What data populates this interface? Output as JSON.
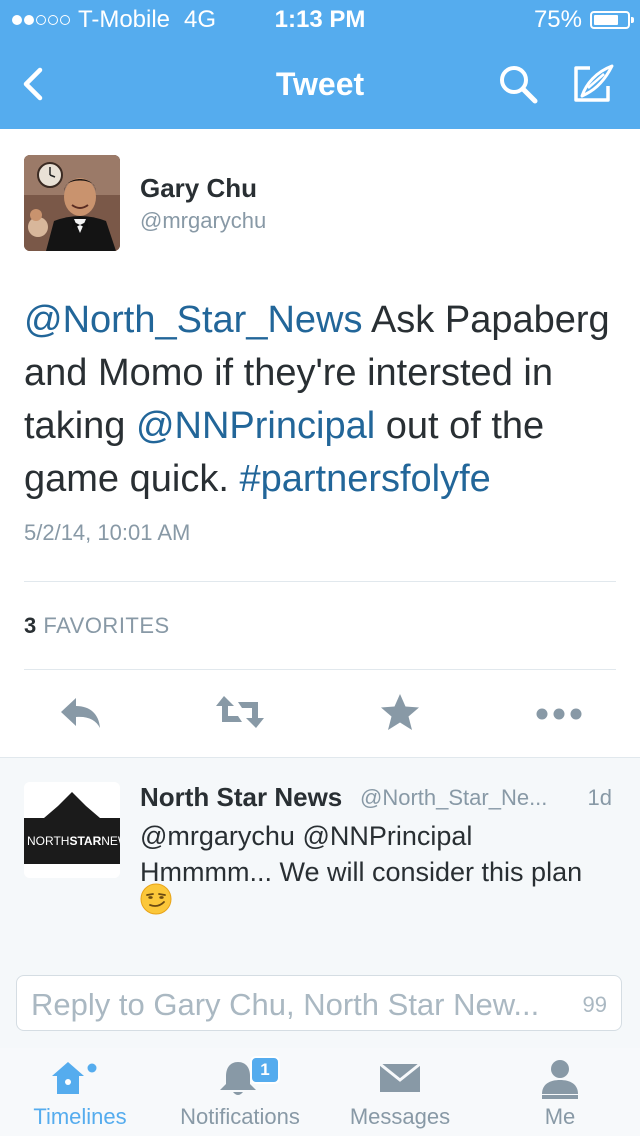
{
  "status_bar": {
    "carrier": "T-Mobile",
    "network": "4G",
    "time": "1:13 PM",
    "battery": "75%",
    "battery_level": 0.75,
    "signal_bars_filled": 2,
    "signal_bars_total": 5
  },
  "nav": {
    "title": "Tweet",
    "back_icon": "chevron-left-icon",
    "search_icon": "search-icon",
    "compose_icon": "compose-icon"
  },
  "tweet": {
    "author_name": "Gary Chu",
    "author_handle": "@mrgarychu",
    "segments": [
      {
        "text": "@North_Star_News",
        "link": true
      },
      {
        "text": " Ask Papaberg and Momo if they're intersted in taking ",
        "link": false
      },
      {
        "text": "@NNPrincipal",
        "link": true
      },
      {
        "text": " out of the game quick. ",
        "link": false
      },
      {
        "text": "#partnersfolyfe",
        "link": true
      }
    ],
    "timestamp": "5/2/14, 10:01 AM",
    "favorites_count": "3",
    "favorites_label": "FAVORITES",
    "actions": [
      "reply-icon",
      "retweet-icon",
      "star-icon",
      "more-icon"
    ]
  },
  "reply": {
    "author_name": "North Star News",
    "author_handle": "@North_Star_Ne...",
    "time": "1d",
    "text_line1": "@mrgarychu @NNPrincipal",
    "text_line2": "Hmmmm... We will consider this plan",
    "emoji": "smirk-emoji",
    "logo_text_plain": "NORTH",
    "logo_text_bold": "STAR",
    "logo_text_end": "NEWS"
  },
  "compose": {
    "placeholder": "Reply to Gary Chu, North Star New...",
    "char_count": "99"
  },
  "tabs": [
    {
      "label": "Timelines",
      "icon": "home-icon",
      "active": true
    },
    {
      "label": "Notifications",
      "icon": "bell-icon",
      "badge": "1"
    },
    {
      "label": "Messages",
      "icon": "envelope-icon"
    },
    {
      "label": "Me",
      "icon": "person-icon"
    }
  ],
  "colors": {
    "brand": "#55acee",
    "link": "#226699",
    "text": "#292f33",
    "muted": "#8899a6"
  }
}
